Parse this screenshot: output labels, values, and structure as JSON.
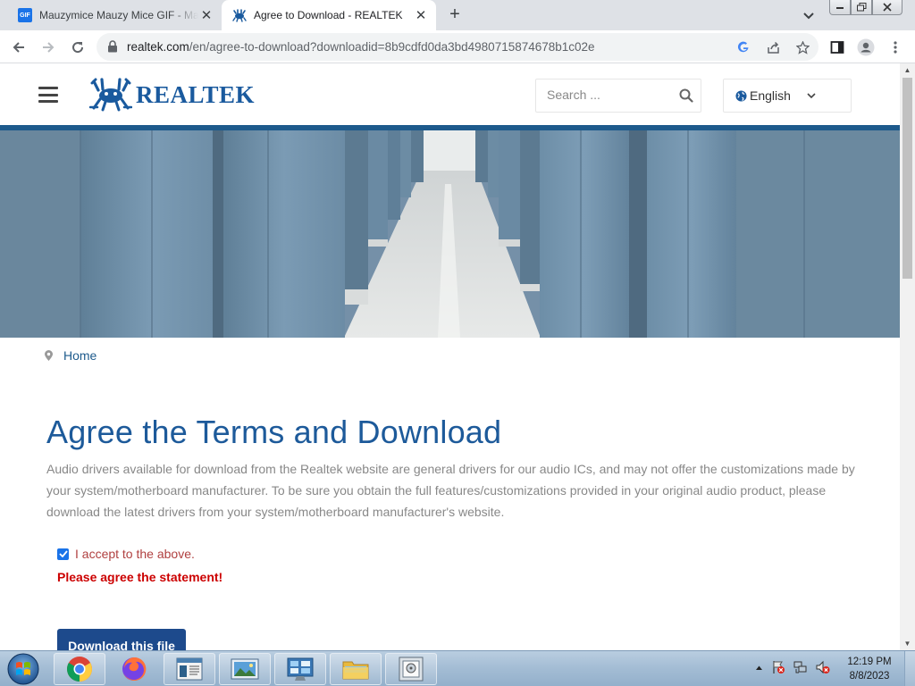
{
  "browser": {
    "tabs": [
      {
        "title": "Mauzymice Mauzy Mice GIF - Ma",
        "favicon": "gif-icon",
        "active": false
      },
      {
        "title": "Agree to Download - REALTEK",
        "favicon": "realtek-crab-icon",
        "active": true
      }
    ],
    "new_tab": "+",
    "url_host": "realtek.com",
    "url_path": "/en/agree-to-download?downloadid=8b9cdfd0da3bd4980715874678b1c02e"
  },
  "header": {
    "logo_text": "REALTEK",
    "search_placeholder": "Search ...",
    "language": "English"
  },
  "breadcrumb": {
    "home": "Home"
  },
  "main": {
    "title": "Agree the Terms and Download",
    "intro": "Audio drivers available for download from the Realtek website are general drivers for our audio ICs, and may not offer the customizations made by your system/motherboard manufacturer. To be sure you obtain the full features/customizations provided in your original audio product, please download the latest drivers from your system/motherboard manufacturer's website.",
    "accept_label": "I accept to the above.",
    "accept_checked": true,
    "warning": "Please agree the statement!",
    "download_button": "Download this file"
  },
  "taskbar": {
    "items": [
      "start-orb-icon",
      "chrome-icon",
      "firefox-icon",
      "notepad-window-icon",
      "photo-viewer-icon",
      "control-panel-icon",
      "file-explorer-icon",
      "disk-utility-icon"
    ],
    "time": "12:19 PM",
    "date": "8/8/2023"
  },
  "colors": {
    "brand_blue": "#1d5a8c",
    "title_blue": "#1d5a9a",
    "warning_red": "#cc0000",
    "button_blue": "#1d4a8c"
  }
}
